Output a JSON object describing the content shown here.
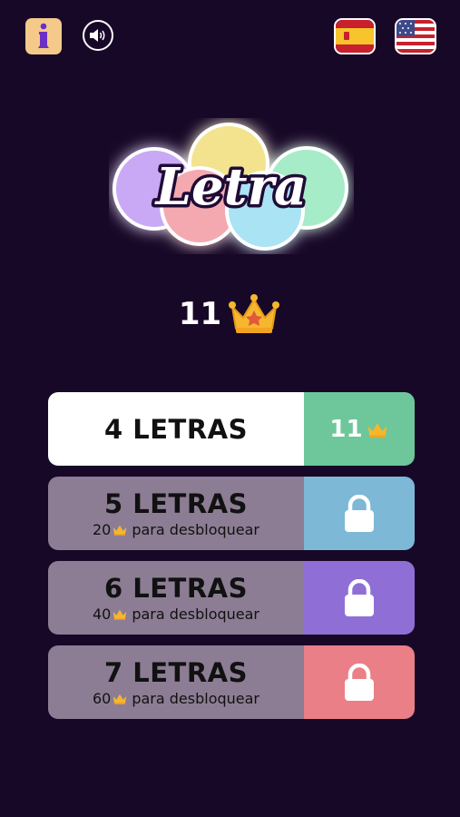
{
  "header": {
    "info_icon": "info-icon",
    "sound_icon": "speaker-icon",
    "flags": [
      {
        "name": "spain-flag-icon",
        "lang": "es"
      },
      {
        "name": "usa-flag-icon",
        "lang": "en"
      }
    ]
  },
  "logo": {
    "text": "Letra"
  },
  "score": {
    "value": "11",
    "icon": "crown-icon"
  },
  "levels": [
    {
      "label": "4 LETRAS",
      "score": "11",
      "color": "#6dc79a",
      "locked": false
    },
    {
      "label": "5 LETRAS",
      "required": "20",
      "unlock_text": "para desbloquear",
      "color": "#7db8d6",
      "locked": true
    },
    {
      "label": "6 LETRAS",
      "required": "40",
      "unlock_text": "para desbloquear",
      "color": "#8f6fd6",
      "locked": true
    },
    {
      "label": "7 LETRAS",
      "required": "60",
      "unlock_text": "para desbloquear",
      "color": "#ea7f87",
      "locked": true
    }
  ],
  "colors": {
    "background": "#180828",
    "locked_panel": "#8c7d94",
    "info_button": "#f4c98a",
    "crown": "#f6b72e"
  }
}
